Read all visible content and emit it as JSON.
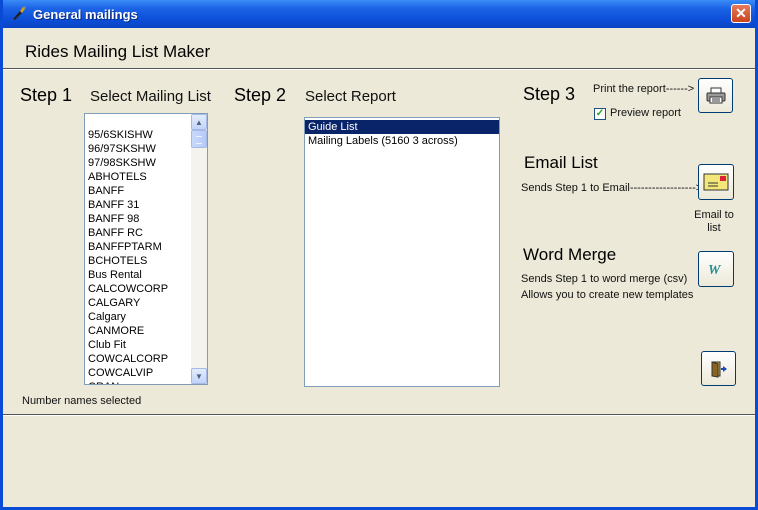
{
  "window": {
    "title": "General mailings",
    "close_glyph": "✕"
  },
  "header": {
    "title": "Rides Mailing List Maker"
  },
  "step1": {
    "label": "Step 1",
    "sublabel": "Select Mailing List",
    "items": [
      "95/6SKISHW",
      "96/97SKSHW",
      "97/98SKSHW",
      "ABHOTELS",
      "BANFF",
      "BANFF 31",
      "BANFF 98",
      "BANFF RC",
      "BANFFPTARM",
      "BCHOTELS",
      "Bus Rental",
      "CALCOWCORP",
      "CALGARY",
      "Calgary",
      "CANMORE",
      "Club Fit",
      "COWCALCORP",
      "COWCALVIP",
      "CRAN"
    ],
    "status": "Number names selected"
  },
  "step2": {
    "label": "Step 2",
    "sublabel": "Select Report",
    "items": [
      "Guide List",
      "Mailing Labels (5160 3 across)"
    ],
    "selected_index": 0
  },
  "step3": {
    "label": "Step 3",
    "print_label": "Print the report------>",
    "preview_label": "Preview report",
    "preview_checked": true,
    "print_icon": "printer-icon"
  },
  "email": {
    "heading": "Email List",
    "desc": "Sends Step 1 to Email------------------>",
    "button_caption_line1": "Email to",
    "button_caption_line2": "list",
    "icon": "envelope-icon"
  },
  "word": {
    "heading": "Word Merge",
    "desc_line1": "Sends Step 1 to word merge (csv)",
    "desc_line2": "Allows you to create new templates",
    "icon": "word-icon"
  },
  "exit": {
    "icon": "exit-door-icon"
  },
  "colors": {
    "titlebar": "#0a4bd6",
    "background": "#ece9d8",
    "selection": "#0a246a"
  }
}
